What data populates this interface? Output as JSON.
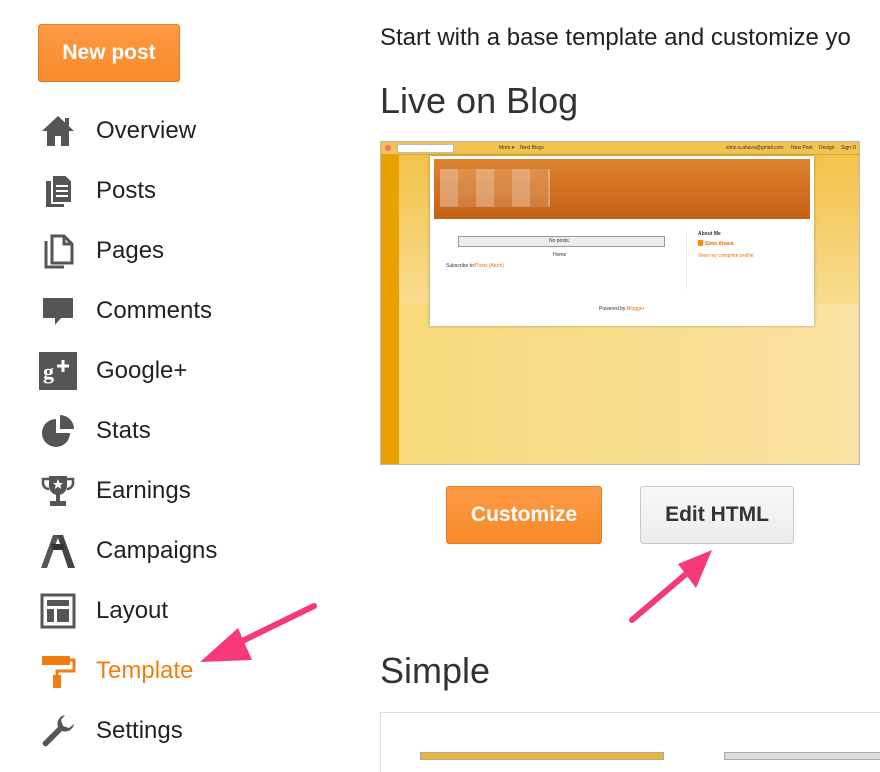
{
  "sidebar": {
    "new_post": "New post",
    "items": [
      {
        "label": "Overview",
        "icon": "home-icon"
      },
      {
        "label": "Posts",
        "icon": "posts-icon"
      },
      {
        "label": "Pages",
        "icon": "pages-icon"
      },
      {
        "label": "Comments",
        "icon": "comment-icon"
      },
      {
        "label": "Google+",
        "icon": "google-plus-icon"
      },
      {
        "label": "Stats",
        "icon": "pie-chart-icon"
      },
      {
        "label": "Earnings",
        "icon": "trophy-icon"
      },
      {
        "label": "Campaigns",
        "icon": "adwords-icon"
      },
      {
        "label": "Layout",
        "icon": "layout-icon"
      },
      {
        "label": "Template",
        "icon": "paint-roller-icon",
        "active": true
      },
      {
        "label": "Settings",
        "icon": "wrench-icon"
      }
    ]
  },
  "main": {
    "intro": "Start with a base template and customize yo",
    "live_heading": "Live on Blog",
    "preview": {
      "nav_more": "More ▾",
      "nav_next": "Next Blog»",
      "email": "simo.a.ahava@gmail.com",
      "new_post": "New Post",
      "design": "Design",
      "sign_out": "Sign O",
      "no_posts": "No posts.",
      "home": "Home",
      "subscribe": "Subscribe to:",
      "subscribe_link": "Posts (Atom)",
      "about_me": "About Me",
      "author": "Simo Ahava",
      "profile_link": "View my complete profile",
      "powered_by": "Powered by",
      "blogger": "Blogger"
    },
    "customize_label": "Customize",
    "edit_html_label": "Edit HTML",
    "simple_heading": "Simple"
  },
  "colors": {
    "accent": "#f17d11",
    "button_orange": "#fd9a45",
    "annotation_arrow": "#f5397a"
  }
}
